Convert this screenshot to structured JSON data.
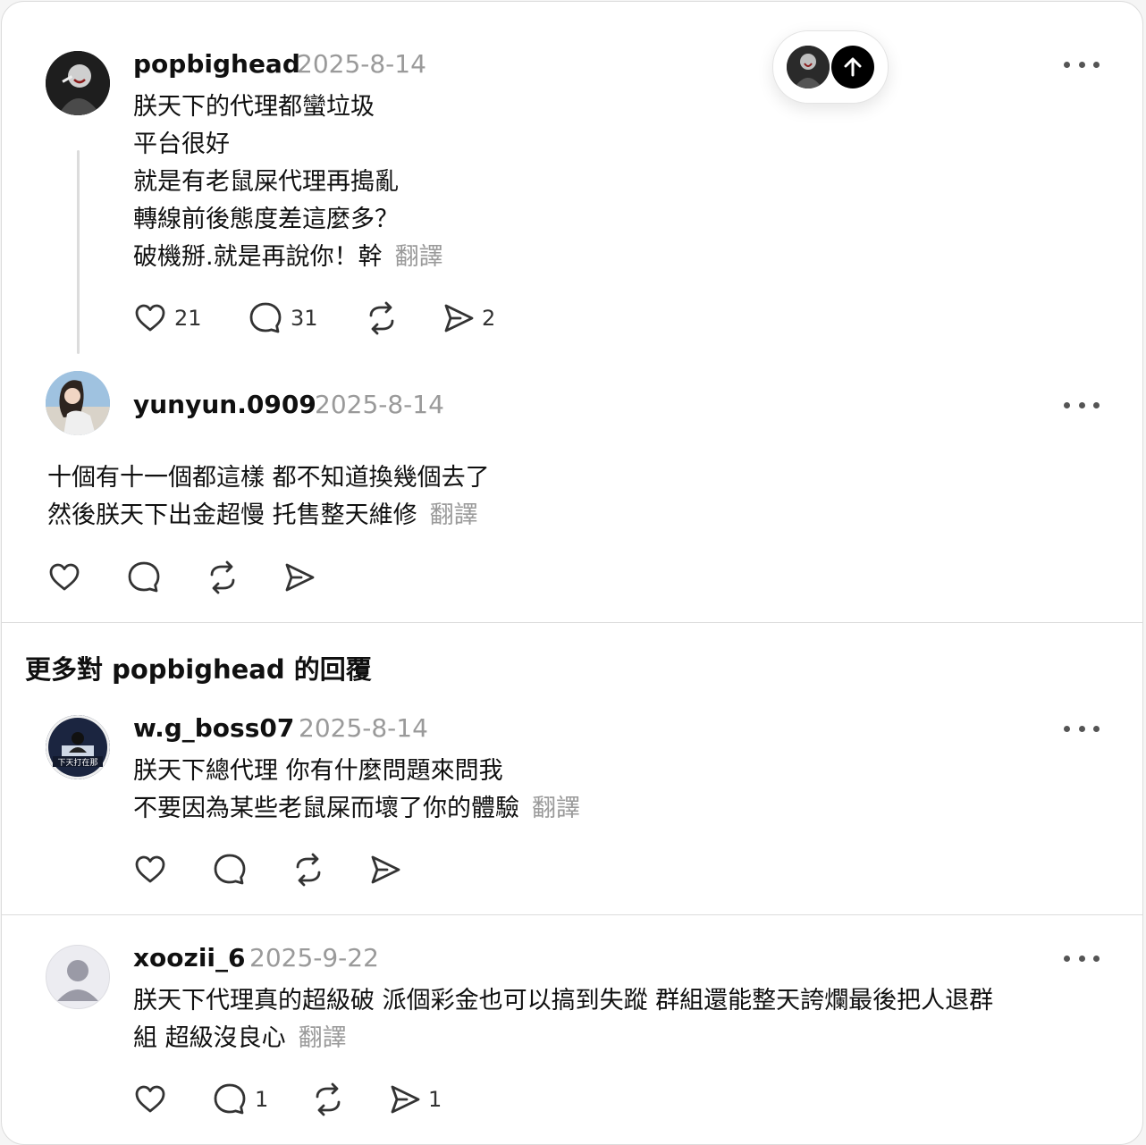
{
  "posts": [
    {
      "username": "popbighead",
      "date": "2025-8-14",
      "lines": [
        "朕天下的代理都蠻垃圾",
        "平台很好",
        "就是有老鼠屎代理再搗亂",
        "轉線前後態度差這麼多？",
        "破機掰.就是再說你！幹"
      ],
      "translate": "翻譯",
      "like_count": "21",
      "reply_count": "31",
      "repost_count": "",
      "share_count": "2"
    },
    {
      "username": "yunyun.0909",
      "date": "2025-8-14",
      "lines": [
        "十個有十一個都這樣 都不知道換幾個去了",
        "然後朕天下出金超慢 托售整天維修"
      ],
      "translate": "翻譯",
      "like_count": "",
      "reply_count": "",
      "repost_count": "",
      "share_count": ""
    }
  ],
  "section_title": "更多對 popbighead 的回覆",
  "replies": [
    {
      "username": "w.g_boss07",
      "date": "2025-8-14",
      "lines": [
        "朕天下總代理 你有什麼問題來問我",
        "不要因為某些老鼠屎而壞了你的體驗"
      ],
      "translate": "翻譯",
      "like_count": "",
      "reply_count": "",
      "repost_count": "",
      "share_count": "",
      "avatar_text": "下天打在那"
    },
    {
      "username": "xoozii_6",
      "date": "2025-9-22",
      "lines": [
        "朕天下代理真的超級破 派個彩金也可以搞到失蹤 群組還能整天誇爛最後把人退群",
        "組 超級沒良心"
      ],
      "translate": "翻譯",
      "like_count": "",
      "reply_count": "1",
      "repost_count": "",
      "share_count": "1"
    }
  ],
  "icons": {
    "like": "heart-icon",
    "reply": "comment-icon",
    "repost": "repost-icon",
    "share": "send-icon",
    "more": "more-icon",
    "scroll_top": "arrow-up-icon"
  }
}
